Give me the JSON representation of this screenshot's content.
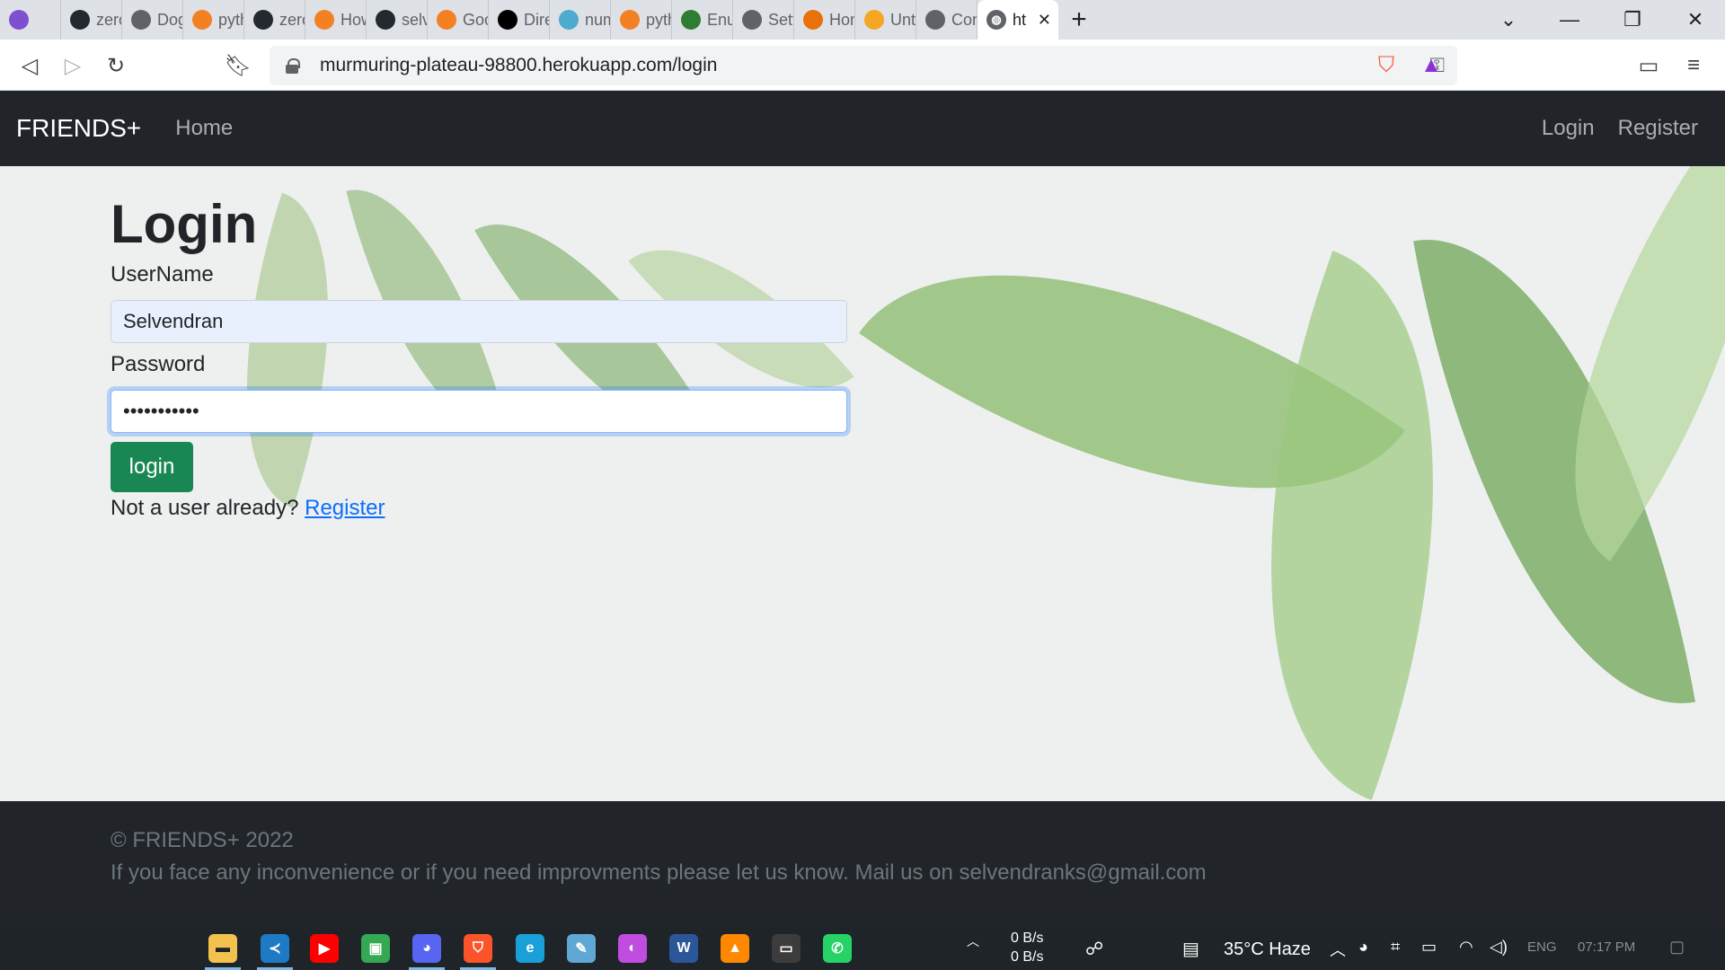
{
  "browser": {
    "tabs": [
      {
        "label": "",
        "icon": "vpn-icon",
        "color": "#7e4fd1"
      },
      {
        "label": "zero",
        "icon": "github-icon",
        "color": "#24292f"
      },
      {
        "label": "Dog",
        "icon": "globe-icon",
        "color": "#5f6368"
      },
      {
        "label": "pyth",
        "icon": "stackoverflow-icon",
        "color": "#f48024"
      },
      {
        "label": "zero",
        "icon": "github-icon",
        "color": "#24292f"
      },
      {
        "label": "How",
        "icon": "stackoverflow-icon",
        "color": "#f48024"
      },
      {
        "label": "selve",
        "icon": "github-icon",
        "color": "#24292f"
      },
      {
        "label": "Goog",
        "icon": "stackoverflow-icon",
        "color": "#f48024"
      },
      {
        "label": "Direc",
        "icon": "te-icon",
        "color": "#000000"
      },
      {
        "label": "nump",
        "icon": "numpy-icon",
        "color": "#4dabcf"
      },
      {
        "label": "pytho",
        "icon": "stackoverflow-icon",
        "color": "#f48024"
      },
      {
        "label": "Enum",
        "icon": "infinity-icon",
        "color": "#2e7d32"
      },
      {
        "label": "Settin",
        "icon": "gear-icon",
        "color": "#5f6368"
      },
      {
        "label": "Hom",
        "icon": "arc-icon",
        "color": "#e8710a"
      },
      {
        "label": "Untitl",
        "icon": "notebook-icon",
        "color": "#f5a623"
      },
      {
        "label": "Cont",
        "icon": "gauge-icon",
        "color": "#5f6368"
      }
    ],
    "active_tab": {
      "label": "ht",
      "icon": "globe-icon"
    },
    "url": "murmuring-plateau-98800.herokuapp.com/login"
  },
  "navbar": {
    "brand": "FRIENDS+",
    "home": "Home",
    "login": "Login",
    "register": "Register"
  },
  "form": {
    "title": "Login",
    "username_label": "UserName",
    "username_value": "Selvendran",
    "password_label": "Password",
    "password_value": "•••••••••••",
    "submit_label": "login",
    "register_prompt": "Not a user already?",
    "register_link": "Register"
  },
  "footer": {
    "copyright": "© FRIENDS+ 2022",
    "message": "If you face any inconvenience or if you need improvments please let us know. Mail us on selvendranks@gmail.com"
  },
  "taskbar": {
    "net_up": "0 B/s",
    "net_down": "0 B/s",
    "weather": "35°C  Haze",
    "lang": "ENG",
    "time": "07:17 PM"
  },
  "colors": {
    "navbar_bg": "#212529",
    "login_button": "#198754",
    "link": "#0d6efd"
  }
}
